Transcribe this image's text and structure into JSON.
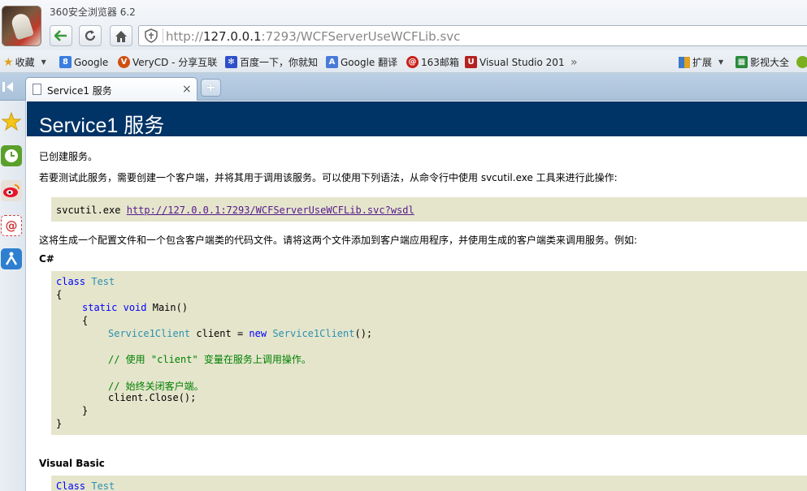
{
  "browser": {
    "app_title": "360安全浏览器 6.2",
    "url": {
      "scheme": "http://",
      "host": "127.0.0.1",
      "rest": ":7293/WCFServerUseWCFLib.svc"
    }
  },
  "bookmarks": [
    {
      "label": "收藏",
      "icon": "star-icon",
      "color": "#e0a020"
    },
    {
      "label": "Google",
      "icon": "google-icon",
      "color": "#3b7de0"
    },
    {
      "label": "VeryCD - 分享互联",
      "icon": "verycd-icon",
      "color": "#d05010"
    },
    {
      "label": "百度一下，你就知",
      "icon": "baidu-icon",
      "color": "#2f4fc8"
    },
    {
      "label": "Google 翻译",
      "icon": "translate-icon",
      "color": "#4a7ad8"
    },
    {
      "label": "163邮箱",
      "icon": "mail163-icon",
      "color": "#c8201a"
    },
    {
      "label": "Visual Studio 201",
      "icon": "visualstudio-icon",
      "color": "#b52020"
    },
    {
      "label": "»",
      "icon": "",
      "color": ""
    },
    {
      "label": "扩展",
      "icon": "extensions-icon",
      "color": "#3a7ac8"
    },
    {
      "label": "影视大全",
      "icon": "film-icon",
      "color": "#2a8a3a"
    }
  ],
  "tab": {
    "label": "Service1 服务",
    "close": "×",
    "new_tab": "+"
  },
  "page": {
    "title": "Service1 服务",
    "created": "已创建服务。",
    "instructions": "若要测试此服务，需要创建一个客户端，并将其用于调用该服务。可以使用下列语法，从命令行中使用 svcutil.exe 工具来进行此操作:",
    "svcutil_cmd": "svcutil.exe",
    "svcutil_link": "http://127.0.0.1:7293/WCFServerUseWCFLib.svc?wsdl",
    "generates": "这将生成一个配置文件和一个包含客户端类的代码文件。请将这两个文件添加到客户端应用程序，并使用生成的客户端类来调用服务。例如:",
    "csharp_heading": "C#",
    "csharp": {
      "class_kw": "class",
      "class_name": "Test",
      "open_brace": "{",
      "close_brace": "}",
      "static_kw": "static",
      "void_kw": "void",
      "main_sig": "Main()",
      "client_type": "Service1Client",
      "client_decl": " client = ",
      "new_kw": "new",
      "client_ctor": "Service1Client",
      "ctor_end": "();",
      "comment1": "// 使用 \"client\" 变量在服务上调用操作。",
      "comment2": "// 始终关闭客户端。",
      "close_call": "client.Close();"
    },
    "vb_heading": "Visual Basic",
    "vb": {
      "class_kw": "Class",
      "class_name": "Test"
    }
  }
}
